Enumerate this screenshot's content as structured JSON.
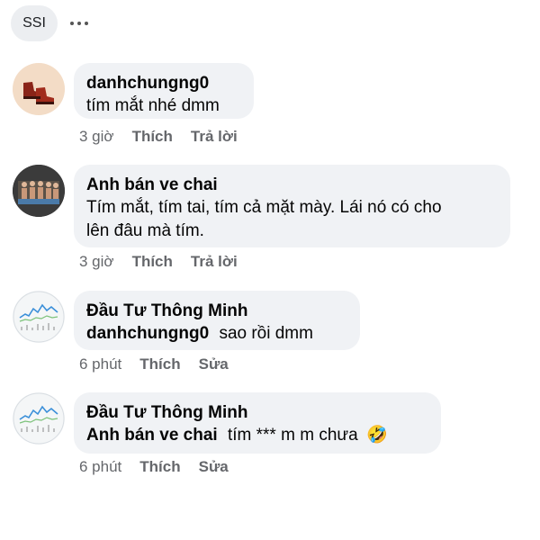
{
  "header": {
    "avatar_label": "SSI"
  },
  "comments": [
    {
      "author": "danhchungng0",
      "text": "tím mắt nhé dmm",
      "time": "3 giờ",
      "like": "Thích",
      "reply": "Trả lời"
    },
    {
      "author": "Anh bán ve chai",
      "text_line1": "Tím mắt, tím tai, tím cả mặt mày. Lái nó có cho",
      "text_line2": "lên đâu mà tím.",
      "time": "3 giờ",
      "like": "Thích",
      "reply": "Trả lời"
    },
    {
      "author": "Đầu Tư Thông Minh",
      "mention": "danhchungng0",
      "text": "sao rồi dmm",
      "time": "6 phút",
      "like": "Thích",
      "edit": "Sửa"
    },
    {
      "author": "Đầu Tư Thông Minh",
      "mention": "Anh bán ve chai",
      "text": "tím *** m m chưa",
      "emoji": "🤣",
      "time": "6 phút",
      "like": "Thích",
      "edit": "Sửa"
    }
  ]
}
